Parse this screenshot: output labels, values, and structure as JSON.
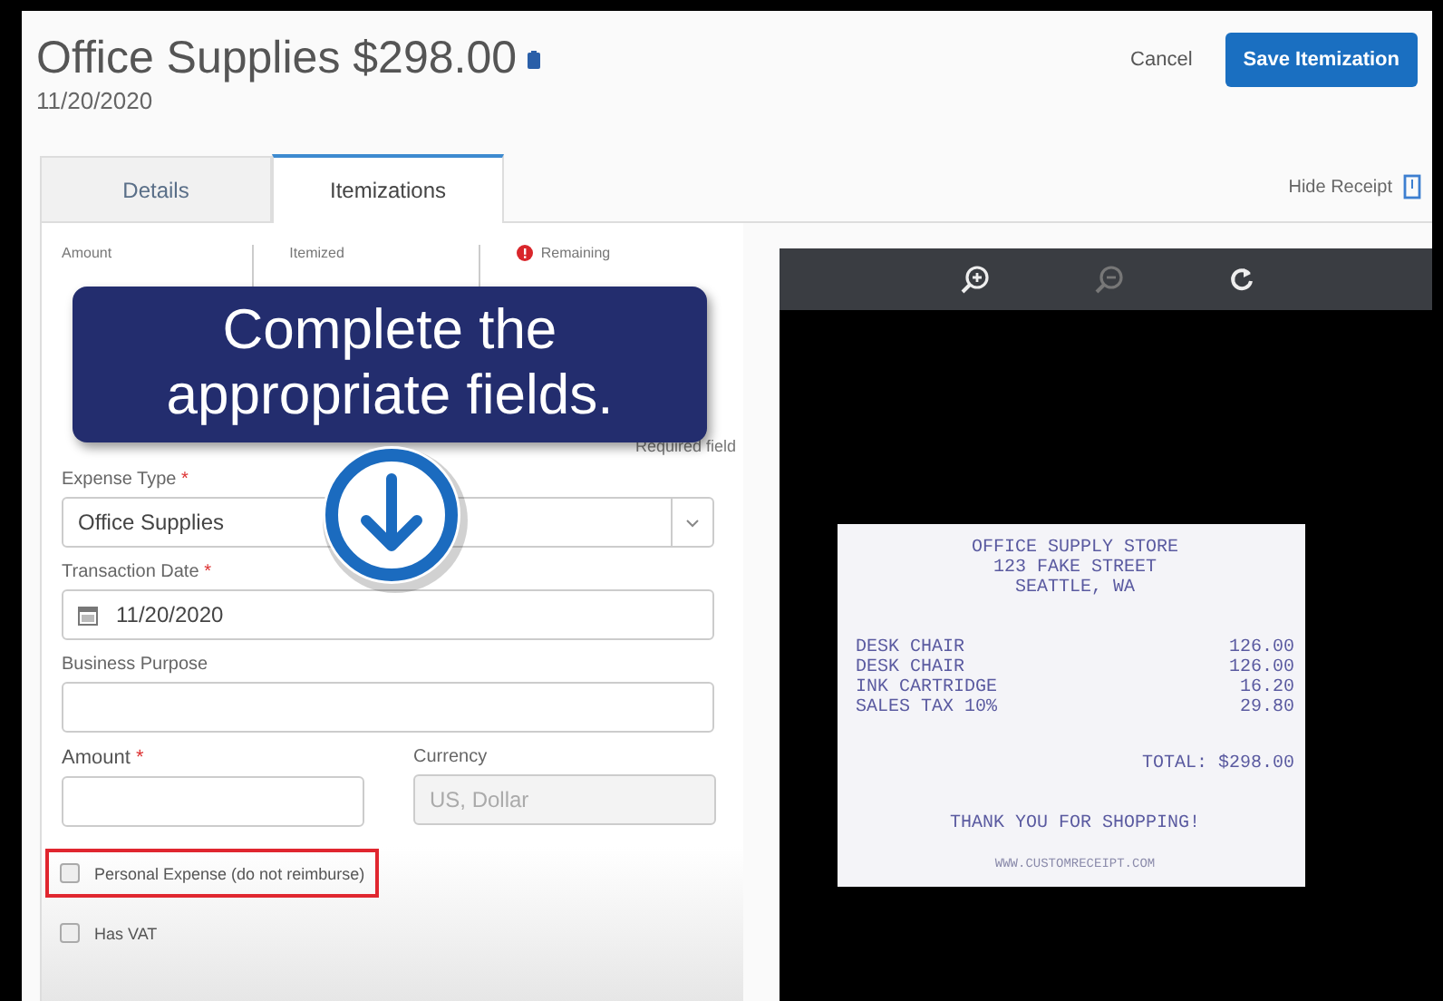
{
  "header": {
    "title": "Office Supplies $298.00",
    "date": "11/20/2020"
  },
  "actions": [
    {
      "label": "Cancel",
      "kind": "link"
    },
    {
      "label": "Save Itemization",
      "kind": "primary"
    }
  ],
  "tabs": [
    {
      "label": "Details",
      "selected": false
    },
    {
      "label": "Itemizations",
      "selected": true
    }
  ],
  "hide_receipt": "Hide Receipt",
  "summary": [
    {
      "label": "Amount",
      "warning": false
    },
    {
      "label": "Itemized",
      "warning": false
    },
    {
      "label": "Remaining",
      "warning": true
    }
  ],
  "required_note": "Required field",
  "callout": {
    "text": "Complete the appropriate fields."
  },
  "expense_type": {
    "label": "Expense Type",
    "required_mark": "*",
    "value": "Office Supplies"
  },
  "transaction_date": {
    "label": "Transaction Date",
    "required_mark": "*",
    "value": "11/20/2020"
  },
  "business_purpose": {
    "label": "Business Purpose"
  },
  "amount": {
    "label": "Amount",
    "required_mark": "*"
  },
  "currency": {
    "label": "Currency",
    "value": "US, Dollar",
    "disabled": true
  },
  "checkboxes": [
    {
      "label": "Personal Expense (do not reimburse)",
      "checked": false,
      "highlighted": true
    },
    {
      "label": "Has VAT",
      "checked": false,
      "highlighted": false
    }
  ],
  "receipt": {
    "header_lines": [
      "OFFICE SUPPLY STORE",
      "123 FAKE STREET",
      "SEATTLE, WA"
    ],
    "items": [
      {
        "name": "DESK CHAIR",
        "price": "126.00"
      },
      {
        "name": "DESK CHAIR",
        "price": "126.00"
      },
      {
        "name": "INK CARTRIDGE",
        "price": "16.20"
      },
      {
        "name": "SALES TAX 10%",
        "price": "29.80"
      }
    ],
    "total": "TOTAL: $298.00",
    "thanks": "THANK YOU FOR SHOPPING!",
    "website": "WWW.CUSTOMRECEIPT.COM"
  }
}
